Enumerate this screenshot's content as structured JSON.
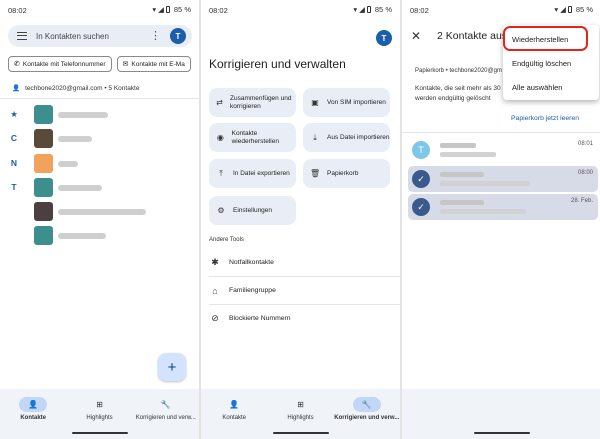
{
  "status": {
    "time": "08:02",
    "battery": "85 %"
  },
  "panel1": {
    "search_placeholder": "In Kontakten suchen",
    "avatar_letter": "T",
    "chips": [
      "Kontakte mit Telefonnummer",
      "Kontakte mit E-Ma"
    ],
    "account": "techbone2020@gmail.com • 5 Kontakte",
    "rows": [
      {
        "letter": "★",
        "color": "#3d8f8f"
      },
      {
        "letter": "C",
        "color": "#5a4a3a"
      },
      {
        "letter": "N",
        "color": "#f2a25c"
      },
      {
        "letter": "T",
        "color": "#3d8f8f"
      },
      {
        "letter": "",
        "color": "#4a4040"
      },
      {
        "letter": "",
        "color": "#3d8f8f"
      }
    ],
    "fab": "+",
    "nav": [
      "Kontakte",
      "Highlights",
      "Korrigieren und verw..."
    ]
  },
  "panel2": {
    "avatar_letter": "T",
    "title": "Korrigieren und verwalten",
    "tiles": [
      {
        "icon": "merge-icon",
        "glyph": "⇄",
        "label": "Zusammenfügen und korrigieren"
      },
      {
        "icon": "sim-icon",
        "glyph": "▣",
        "label": "Von SIM importieren"
      },
      {
        "icon": "restore-icon",
        "glyph": "◉",
        "label": "Kontakte wiederherstellen"
      },
      {
        "icon": "download-icon",
        "glyph": "⤓",
        "label": "Aus Datei importieren"
      },
      {
        "icon": "upload-icon",
        "glyph": "⤒",
        "label": "In Datei exportieren"
      },
      {
        "icon": "trash-icon",
        "glyph": "🗑",
        "label": "Papierkorb"
      },
      {
        "icon": "settings-icon",
        "glyph": "⚙",
        "label": "Einstellungen"
      }
    ],
    "section": "Andere Tools",
    "tools": [
      {
        "icon": "emergency-icon",
        "glyph": "✱",
        "label": "Notfallkontakte"
      },
      {
        "icon": "family-icon",
        "glyph": "⌂",
        "label": "Familiengruppe"
      },
      {
        "icon": "block-icon",
        "glyph": "⊘",
        "label": "Blockierte Nummern"
      }
    ],
    "nav": [
      "Kontakte",
      "Highlights",
      "Korrigieren und verw..."
    ]
  },
  "panel3": {
    "title": "2 Kontakte aus",
    "account": "Papierkorb • techbone2020@gm",
    "info_line1": "Kontakte, die seit mehr als 30",
    "info_line2": "werden endgültig gelöscht",
    "empty": "Papierkorb jetzt leeren",
    "rows": [
      {
        "circle": "T",
        "date": "08:01",
        "selected": false
      },
      {
        "circle": "✓",
        "date": "08:00",
        "selected": true
      },
      {
        "circle": "✓",
        "date": "28. Feb.",
        "selected": true
      }
    ],
    "menu": [
      "Wiederherstellen",
      "Endgültig löschen",
      "Alle auswählen"
    ]
  }
}
